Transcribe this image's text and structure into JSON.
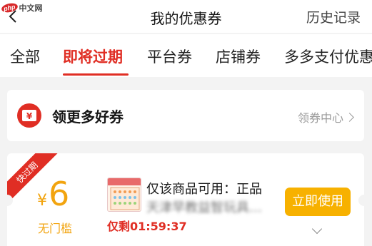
{
  "watermark": {
    "php": "php",
    "site": "中文网"
  },
  "header": {
    "title": "我的优惠券",
    "history": "历史记录"
  },
  "tabs": [
    {
      "label": "全部"
    },
    {
      "label": "即将过期"
    },
    {
      "label": "平台券"
    },
    {
      "label": "店铺券"
    },
    {
      "label": "多多支付优惠"
    }
  ],
  "get_coupons": {
    "title": "领更多好券",
    "center_link": "领券中心"
  },
  "coupon": {
    "ribbon": "快过期",
    "currency": "¥",
    "amount": "6",
    "threshold": "无门槛",
    "desc_line1": "仅该商品可用：正品",
    "desc_line2": "天津早教益智玩具…",
    "countdown": "仅剩01:59:37",
    "use_button": "立即使用"
  },
  "colors": {
    "accent": "#e02e24",
    "coupon_orange": "#f2a40f",
    "button": "#f7b100"
  },
  "icons": [
    "back-chevron-icon",
    "ticket-icon",
    "chevron-right-icon",
    "chevron-down-icon"
  ]
}
